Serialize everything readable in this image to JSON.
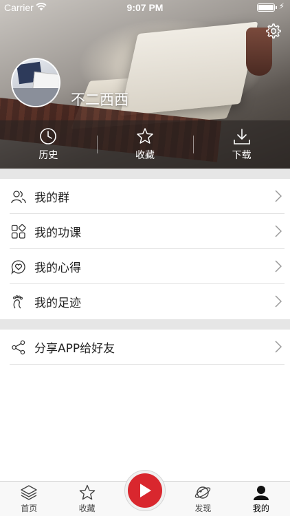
{
  "status_bar": {
    "carrier": "Carrier",
    "time": "9:07 PM"
  },
  "profile": {
    "username": "不二西西"
  },
  "quick_actions": [
    {
      "label": "历史",
      "icon": "clock-icon"
    },
    {
      "label": "收藏",
      "icon": "star-icon"
    },
    {
      "label": "下载",
      "icon": "download-icon"
    }
  ],
  "menu_group_1": [
    {
      "label": "我的群",
      "icon": "group-icon"
    },
    {
      "label": "我的功课",
      "icon": "grid-icon"
    },
    {
      "label": "我的心得",
      "icon": "heart-bubble-icon"
    },
    {
      "label": "我的足迹",
      "icon": "footprint-icon"
    }
  ],
  "menu_group_2": [
    {
      "label": "分享APP给好友",
      "icon": "share-icon"
    }
  ],
  "tabbar": {
    "tabs": [
      {
        "label": "首页",
        "icon": "layers-icon"
      },
      {
        "label": "收藏",
        "icon": "star-icon"
      },
      {
        "label": "发现",
        "icon": "planet-icon"
      },
      {
        "label": "我的",
        "icon": "user-icon"
      }
    ],
    "active": "我的",
    "center_icon": "play-icon"
  },
  "colors": {
    "accent_red": "#d9272e",
    "divider_gray": "#e6e6e6"
  }
}
